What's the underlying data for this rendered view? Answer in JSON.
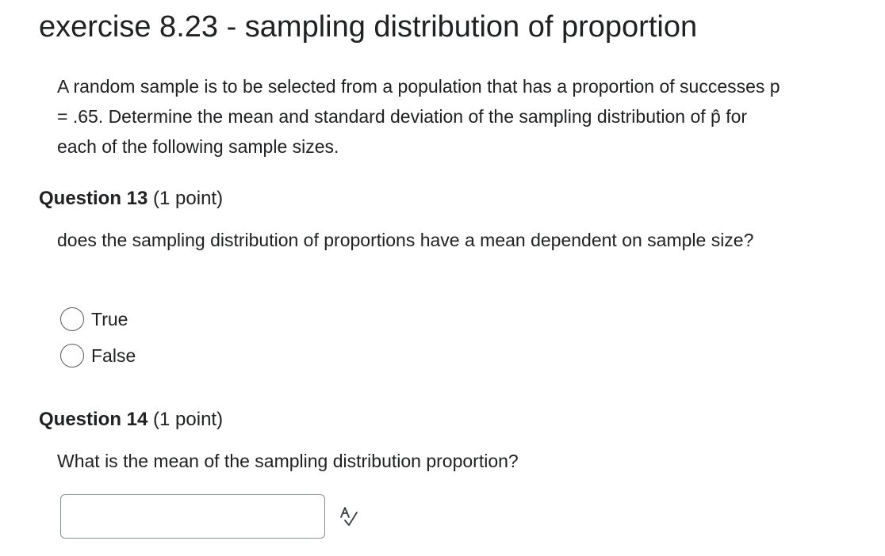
{
  "page": {
    "title": "exercise 8.23 - sampling distribution of proportion",
    "intro": "A random sample is to be selected from a population that has a proportion of successes p = .65. Determine the mean and standard deviation of the sampling distribution of p̂ for each of the following sample sizes."
  },
  "questions": [
    {
      "label": "Question 13",
      "points": " (1 point)",
      "text": "does the sampling distribution of proportions have a mean dependent on sample size?",
      "options": [
        {
          "label": "True",
          "selected": false
        },
        {
          "label": "False",
          "selected": false
        }
      ]
    },
    {
      "label": "Question 14",
      "points": " (1 point)",
      "text": "What is the mean of the sampling distribution proportion?",
      "answer": {
        "value": "",
        "placeholder": ""
      },
      "tool_icon": "spell-check-icon"
    }
  ],
  "colors": {
    "text": "#202122",
    "border": "#8a8f93",
    "radio_border": "#565a5c"
  }
}
